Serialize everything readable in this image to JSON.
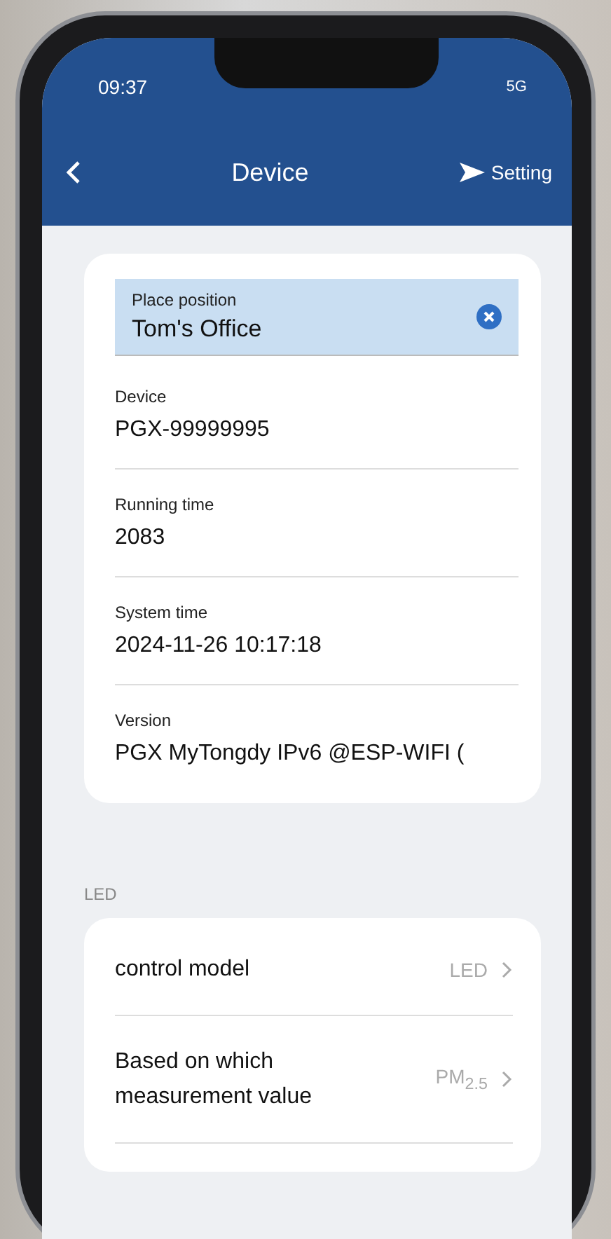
{
  "status_bar": {
    "time": "09:37",
    "network": "5G"
  },
  "header": {
    "title": "Device",
    "action": "Setting"
  },
  "place_field": {
    "label": "Place position",
    "value": "Tom's Office"
  },
  "info_rows": [
    {
      "label": "Device",
      "value": "PGX-99999995"
    },
    {
      "label": "Running time",
      "value": "2083"
    },
    {
      "label": "System time",
      "value": "2024-11-26 10:17:18"
    },
    {
      "label": "Version",
      "value": "PGX MyTongdy IPv6 @ESP-WIFI ("
    }
  ],
  "section": {
    "title": "LED"
  },
  "settings": [
    {
      "label": "control model",
      "value": "LED"
    },
    {
      "label": "Based on which measurement value",
      "value": "PM$_{2.5}$"
    }
  ]
}
